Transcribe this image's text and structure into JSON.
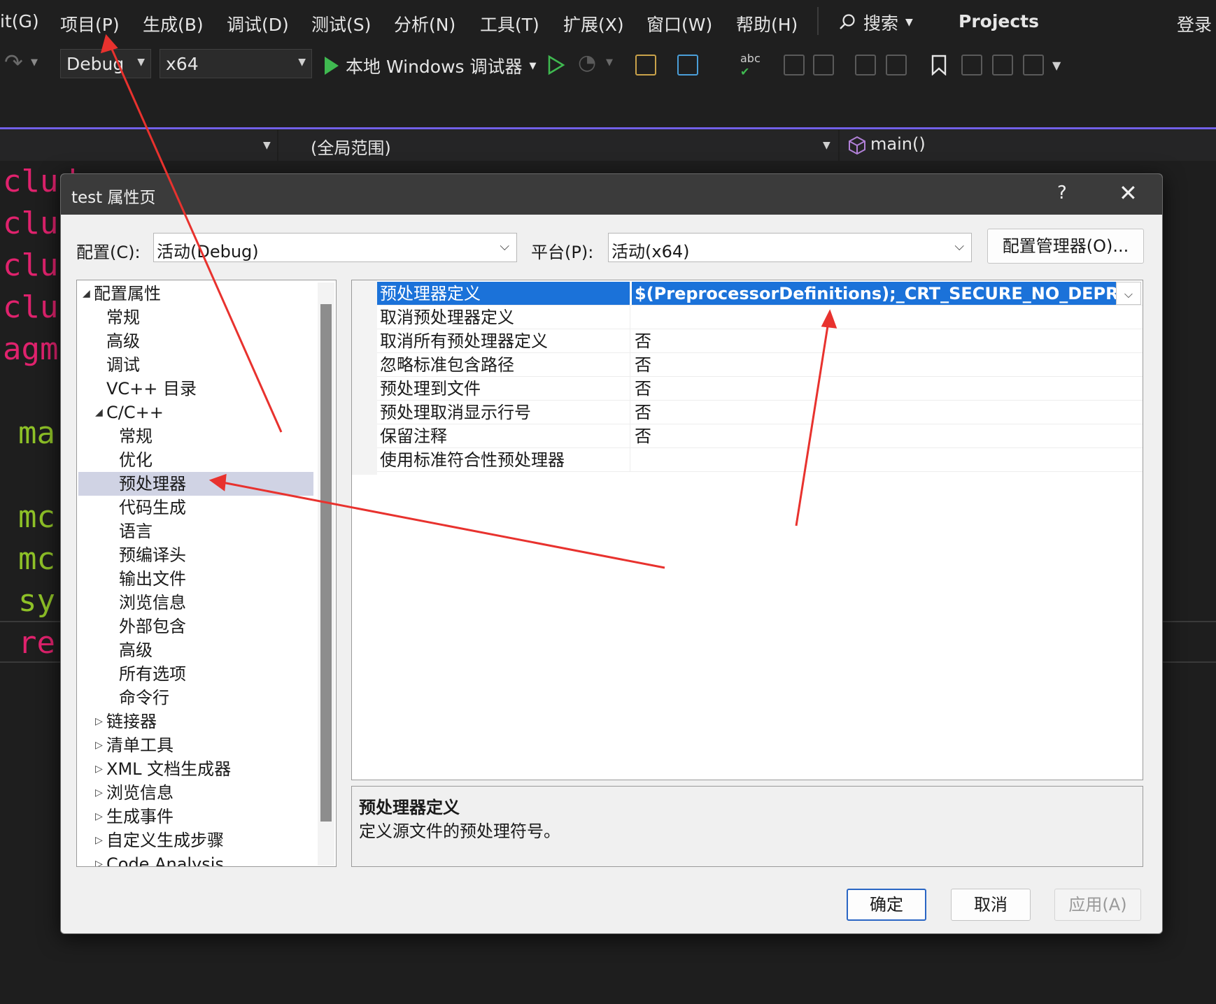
{
  "menu": {
    "items": [
      "it(G)",
      "项目(P)",
      "生成(B)",
      "调试(D)",
      "测试(S)",
      "分析(N)",
      "工具(T)",
      "扩展(X)",
      "窗口(W)",
      "帮助(H)"
    ],
    "search_label": "搜索",
    "projects_label": "Projects",
    "login_label": "登录"
  },
  "toolbar": {
    "config_value": "Debug",
    "platform_value": "x64",
    "run_label": "本地 Windows 调试器"
  },
  "navbar": {
    "scope": "(全局范围)",
    "member": "main()"
  },
  "editor": {
    "lines": [
      "clud",
      "clud",
      "clud",
      "clud",
      "agma",
      "ma:",
      "mc:",
      "mc:",
      "sy:",
      "re"
    ]
  },
  "dialog": {
    "title": "test 属性页",
    "help": "?",
    "close": "✕",
    "config_label": "配置(C):",
    "config_value": "活动(Debug)",
    "platform_label": "平台(P):",
    "platform_value": "活动(x64)",
    "config_manager_button": "配置管理器(O)...",
    "tree": [
      {
        "label": "配置属性",
        "toggle": "◢"
      },
      {
        "label": "常规",
        "toggle": ""
      },
      {
        "label": "高级",
        "toggle": ""
      },
      {
        "label": "调试",
        "toggle": ""
      },
      {
        "label": "VC++ 目录",
        "toggle": ""
      },
      {
        "label": "C/C++",
        "toggle": "◢"
      },
      {
        "label": "常规",
        "toggle": ""
      },
      {
        "label": "优化",
        "toggle": ""
      },
      {
        "label": "预处理器",
        "toggle": ""
      },
      {
        "label": "代码生成",
        "toggle": ""
      },
      {
        "label": "语言",
        "toggle": ""
      },
      {
        "label": "预编译头",
        "toggle": ""
      },
      {
        "label": "输出文件",
        "toggle": ""
      },
      {
        "label": "浏览信息",
        "toggle": ""
      },
      {
        "label": "外部包含",
        "toggle": ""
      },
      {
        "label": "高级",
        "toggle": ""
      },
      {
        "label": "所有选项",
        "toggle": ""
      },
      {
        "label": "命令行",
        "toggle": ""
      },
      {
        "label": "链接器",
        "toggle": "▷"
      },
      {
        "label": "清单工具",
        "toggle": "▷"
      },
      {
        "label": "XML 文档生成器",
        "toggle": "▷"
      },
      {
        "label": "浏览信息",
        "toggle": "▷"
      },
      {
        "label": "生成事件",
        "toggle": "▷"
      },
      {
        "label": "自定义生成步骤",
        "toggle": "▷"
      },
      {
        "label": "Code Analysis",
        "toggle": "▷"
      }
    ],
    "grid": [
      {
        "name": "预处理器定义",
        "value": "$(PreprocessorDefinitions);_CRT_SECURE_NO_DEPRECATE"
      },
      {
        "name": "取消预处理器定义",
        "value": ""
      },
      {
        "name": "取消所有预处理器定义",
        "value": "否"
      },
      {
        "name": "忽略标准包含路径",
        "value": "否"
      },
      {
        "name": "预处理到文件",
        "value": "否"
      },
      {
        "name": "预处理取消显示行号",
        "value": "否"
      },
      {
        "name": "保留注释",
        "value": "否"
      },
      {
        "name": "使用标准符合性预处理器",
        "value": ""
      }
    ],
    "description": {
      "title": "预处理器定义",
      "text": "定义源文件的预处理符号。"
    },
    "ok_button": "确定",
    "cancel_button": "取消",
    "apply_button": "应用(A)"
  },
  "colors": {
    "accent": "#1b72d9",
    "annotation_arrow": "#e8322e",
    "ide_purple": "#7160e8",
    "run_green": "#3fb950"
  }
}
